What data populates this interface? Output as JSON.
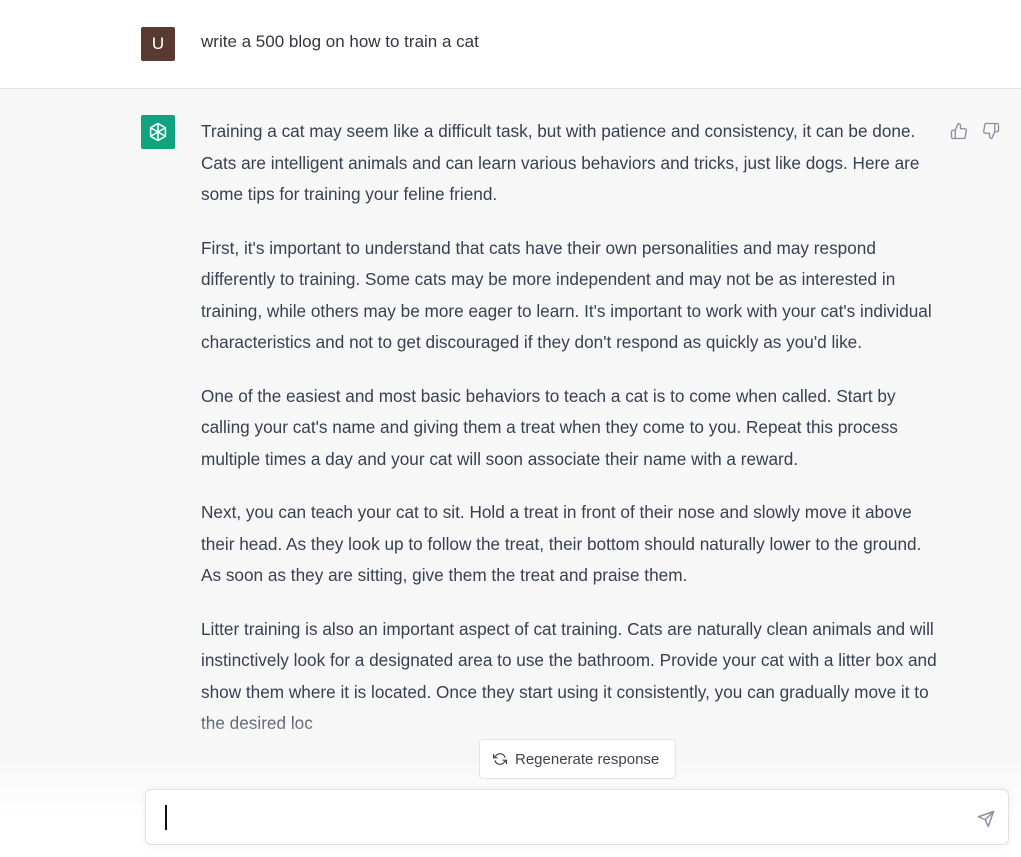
{
  "user_message": {
    "avatar_letter": "U",
    "text": "write a 500 blog on how to train a cat"
  },
  "assistant_message": {
    "paragraphs": [
      "Training a cat may seem like a difficult task, but with patience and consistency, it can be done. Cats are intelligent animals and can learn various behaviors and tricks, just like dogs. Here are some tips for training your feline friend.",
      "First, it's important to understand that cats have their own personalities and may respond differently to training. Some cats may be more independent and may not be as interested in training, while others may be more eager to learn. It's important to work with your cat's individual characteristics and not to get discouraged if they don't respond as quickly as you'd like.",
      "One of the easiest and most basic behaviors to teach a cat is to come when called. Start by calling your cat's name and giving them a treat when they come to you. Repeat this process multiple times a day and your cat will soon associate their name with a reward.",
      "Next, you can teach your cat to sit. Hold a treat in front of their nose and slowly move it above their head. As they look up to follow the treat, their bottom should naturally lower to the ground. As soon as they are sitting, give them the treat and praise them.",
      "Litter training is also an important aspect of cat training. Cats are naturally clean animals and will instinctively look for a designated area to use the bathroom. Provide your cat with a litter box and show them where it is located. Once they start using it consistently, you can gradually move it to the desired loc"
    ]
  },
  "controls": {
    "regenerate_label": "Regenerate response",
    "input_placeholder": ""
  },
  "icons": {
    "user_avatar": "user-avatar",
    "assistant_avatar": "openai-logo-icon",
    "thumbs_up": "thumbs-up-icon",
    "thumbs_down": "thumbs-down-icon",
    "regenerate": "refresh-icon",
    "send": "send-icon"
  },
  "colors": {
    "user_avatar_bg": "#5a3a30",
    "assistant_avatar_bg": "#10a37f",
    "assistant_row_bg": "#f7f7f8"
  }
}
